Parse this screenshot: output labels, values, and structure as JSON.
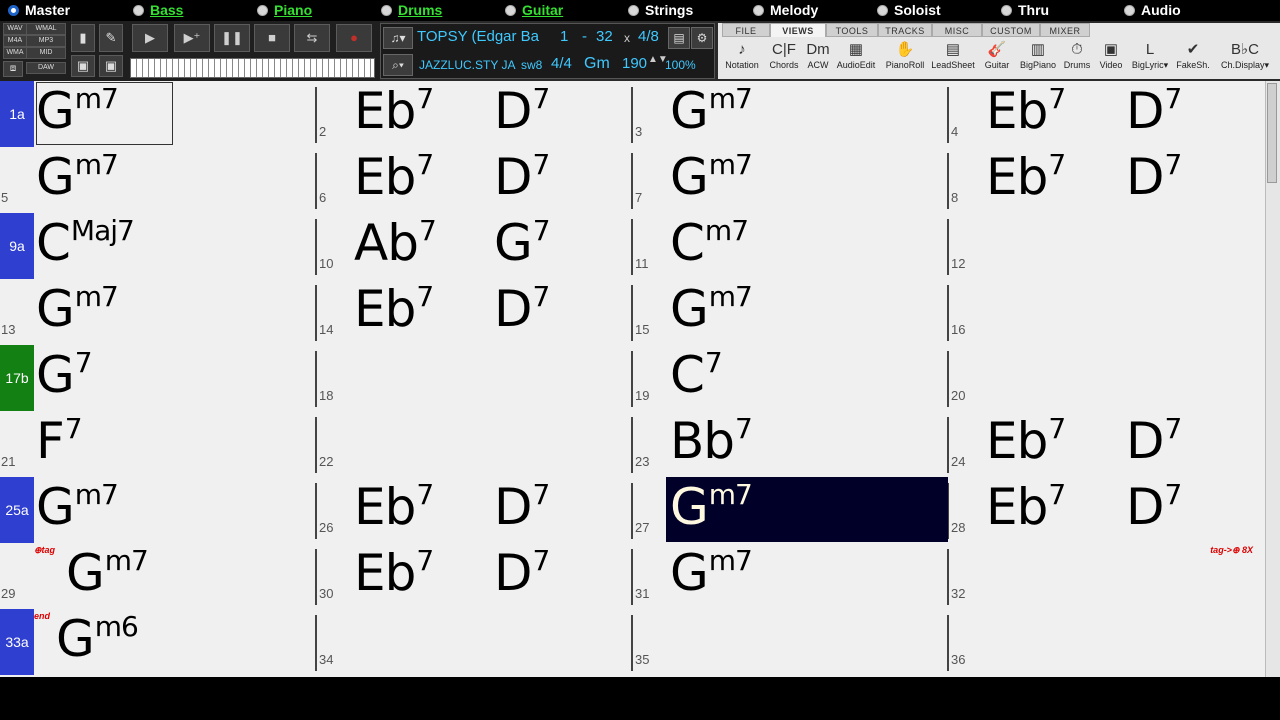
{
  "tracks": [
    {
      "label": "Master",
      "color": "white",
      "selected": true
    },
    {
      "label": "Bass",
      "color": "green",
      "selected": false
    },
    {
      "label": "Piano",
      "color": "green",
      "selected": false
    },
    {
      "label": "Drums",
      "color": "green",
      "selected": false
    },
    {
      "label": "Guitar",
      "color": "green",
      "selected": false
    },
    {
      "label": "Strings",
      "color": "white",
      "selected": false
    },
    {
      "label": "Melody",
      "color": "white",
      "selected": false
    },
    {
      "label": "Soloist",
      "color": "white",
      "selected": false
    },
    {
      "label": "Thru",
      "color": "white",
      "selected": false
    },
    {
      "label": "Audio",
      "color": "white",
      "selected": false
    }
  ],
  "formats": [
    "WAV",
    "WMAL",
    "M4A",
    "MP3",
    "WMA",
    "MID",
    "DAW"
  ],
  "song": {
    "title": "TOPSY (Edgar Ba",
    "range_start": "1",
    "range_sep": "-",
    "range_end": "32",
    "times_label": "x",
    "choruses": "4/8",
    "style": "JAZZLUC.STY JA",
    "feel": "sw8",
    "time_sig": "4/4",
    "key": "Gm",
    "tempo": "190",
    "volume": "100%"
  },
  "view_tabs": [
    "FILE",
    "VIEWS",
    "TOOLS",
    "TRACKS",
    "MISC",
    "CUSTOM",
    "MIXER"
  ],
  "active_tab": "VIEWS",
  "view_buttons": [
    {
      "label": "Notation",
      "icon": "note-icon"
    },
    {
      "label": "Chords",
      "icon": "chords-icon"
    },
    {
      "label": "ACW",
      "icon": "acw-icon"
    },
    {
      "label": "AudioEdit",
      "icon": "audioedit-icon"
    },
    {
      "label": "PianoRoll",
      "icon": "pianoroll-icon"
    },
    {
      "label": "LeadSheet",
      "icon": "leadsheet-icon"
    },
    {
      "label": "Guitar",
      "icon": "guitar-icon"
    },
    {
      "label": "BigPiano",
      "icon": "bigpiano-icon"
    },
    {
      "label": "Drums",
      "icon": "drums-icon"
    },
    {
      "label": "Video",
      "icon": "video-icon"
    },
    {
      "label": "BigLyric▾",
      "icon": "biglyric-icon"
    },
    {
      "label": "FakeSh.",
      "icon": "fakesheet-icon"
    },
    {
      "label": "Ch.Display▾",
      "icon": "chdisplay-icon"
    }
  ],
  "bars": [
    {
      "num": "1a",
      "section": "blue",
      "chords": [
        {
          "root": "G",
          "ext": "m7"
        }
      ]
    },
    {
      "num": "2",
      "chords": [
        {
          "root": "Eb",
          "ext": "7"
        },
        {
          "root": "D",
          "ext": "7"
        }
      ]
    },
    {
      "num": "3",
      "chords": [
        {
          "root": "G",
          "ext": "m7"
        }
      ]
    },
    {
      "num": "4",
      "chords": [
        {
          "root": "Eb",
          "ext": "7"
        },
        {
          "root": "D",
          "ext": "7"
        }
      ]
    },
    {
      "num": "5",
      "chords": [
        {
          "root": "G",
          "ext": "m7"
        }
      ]
    },
    {
      "num": "6",
      "chords": [
        {
          "root": "Eb",
          "ext": "7"
        },
        {
          "root": "D",
          "ext": "7"
        }
      ]
    },
    {
      "num": "7",
      "chords": [
        {
          "root": "G",
          "ext": "m7"
        }
      ]
    },
    {
      "num": "8",
      "chords": [
        {
          "root": "Eb",
          "ext": "7"
        },
        {
          "root": "D",
          "ext": "7"
        }
      ]
    },
    {
      "num": "9a",
      "section": "blue",
      "chords": [
        {
          "root": "C",
          "ext": "Maj7"
        }
      ]
    },
    {
      "num": "10",
      "chords": [
        {
          "root": "Ab",
          "ext": "7"
        },
        {
          "root": "G",
          "ext": "7"
        }
      ]
    },
    {
      "num": "11",
      "chords": [
        {
          "root": "C",
          "ext": "m7"
        }
      ]
    },
    {
      "num": "12",
      "chords": []
    },
    {
      "num": "13",
      "chords": [
        {
          "root": "G",
          "ext": "m7"
        }
      ]
    },
    {
      "num": "14",
      "chords": [
        {
          "root": "Eb",
          "ext": "7"
        },
        {
          "root": "D",
          "ext": "7"
        }
      ]
    },
    {
      "num": "15",
      "chords": [
        {
          "root": "G",
          "ext": "m7"
        }
      ]
    },
    {
      "num": "16",
      "chords": []
    },
    {
      "num": "17b",
      "section": "green",
      "chords": [
        {
          "root": "G",
          "ext": "7"
        }
      ]
    },
    {
      "num": "18",
      "chords": []
    },
    {
      "num": "19",
      "chords": [
        {
          "root": "C",
          "ext": "7"
        }
      ]
    },
    {
      "num": "20",
      "chords": []
    },
    {
      "num": "21",
      "chords": [
        {
          "root": "F",
          "ext": "7"
        }
      ]
    },
    {
      "num": "22",
      "chords": []
    },
    {
      "num": "23",
      "chords": [
        {
          "root": "Bb",
          "ext": "7"
        }
      ]
    },
    {
      "num": "24",
      "chords": [
        {
          "root": "Eb",
          "ext": "7"
        },
        {
          "root": "D",
          "ext": "7"
        }
      ]
    },
    {
      "num": "25a",
      "section": "blue",
      "chords": [
        {
          "root": "G",
          "ext": "m7"
        }
      ]
    },
    {
      "num": "26",
      "chords": [
        {
          "root": "Eb",
          "ext": "7"
        },
        {
          "root": "D",
          "ext": "7"
        }
      ]
    },
    {
      "num": "27",
      "highlight": true,
      "chords": [
        {
          "root": "G",
          "ext": "m7"
        }
      ]
    },
    {
      "num": "28",
      "chords": [
        {
          "root": "Eb",
          "ext": "7"
        },
        {
          "root": "D",
          "ext": "7"
        }
      ]
    },
    {
      "num": "29",
      "tag": "⊕tag",
      "chords": [
        {
          "root": "G",
          "ext": "m7"
        }
      ]
    },
    {
      "num": "30",
      "chords": [
        {
          "root": "Eb",
          "ext": "7"
        },
        {
          "root": "D",
          "ext": "7"
        }
      ]
    },
    {
      "num": "31",
      "chords": [
        {
          "root": "G",
          "ext": "m7"
        }
      ]
    },
    {
      "num": "32",
      "tag_right": "tag->⊕ 8X",
      "chords": []
    },
    {
      "num": "33a",
      "section": "blue",
      "tag": "end",
      "chords": [
        {
          "root": "G",
          "ext": "m6"
        }
      ]
    },
    {
      "num": "34",
      "chords": []
    },
    {
      "num": "35",
      "chords": []
    },
    {
      "num": "36",
      "chords": []
    }
  ]
}
